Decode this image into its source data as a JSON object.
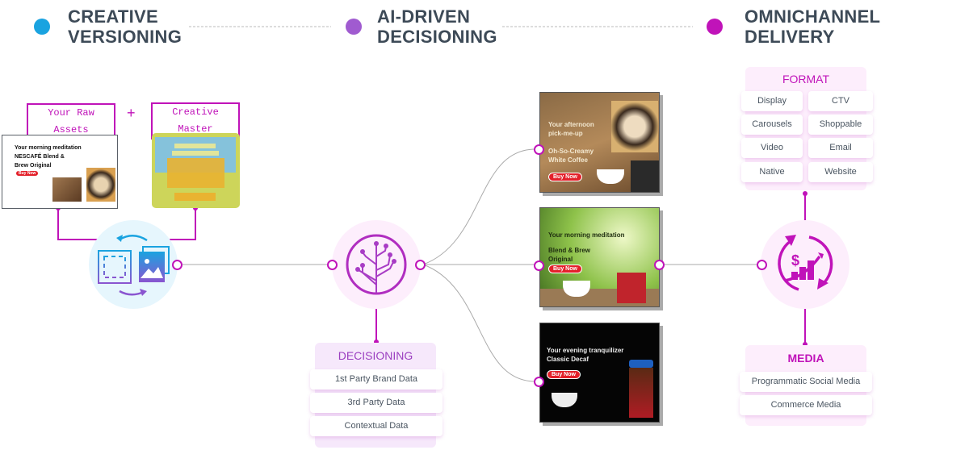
{
  "stages": [
    {
      "title_line1": "CREATIVE",
      "title_line2": "VERSIONING",
      "color": "#1aa3e0"
    },
    {
      "title_line1": "AI-DRIVEN",
      "title_line2": "DECISIONING",
      "color": "#a05bd0"
    },
    {
      "title_line1": "OMNICHANNEL",
      "title_line2": "DELIVERY",
      "color": "#c013b9"
    }
  ],
  "inputs": {
    "raw_assets": "Your Raw Assets",
    "plus": "+",
    "creative_master": "Creative Master"
  },
  "raw_ad": {
    "headline": "Your morning meditation",
    "product": "NESCAFÉ Blend & Brew Original",
    "cta": "Buy Now"
  },
  "ads": [
    {
      "headline": "Your afternoon pick-me-up",
      "product": "Oh-So-Creamy White Coffee",
      "cta": "Buy Now"
    },
    {
      "headline": "Your morning meditation",
      "product": "Blend & Brew Original",
      "cta": "Buy Now"
    },
    {
      "headline": "Your evening tranquilizer",
      "product": "Classic Decaf",
      "cta": "Buy Now"
    }
  ],
  "decisioning": {
    "title": "DECISIONING",
    "items": [
      "1st Party Brand Data",
      "3rd Party Data",
      "Contextual Data"
    ]
  },
  "format": {
    "title": "FORMAT",
    "items": [
      "Display",
      "CTV",
      "Carousels",
      "Shoppable",
      "Video",
      "Email",
      "Native",
      "Website"
    ]
  },
  "media": {
    "title": "MEDIA",
    "items": [
      "Programmatic Social Media",
      "Commerce Media"
    ]
  },
  "icons": [
    "image-versioning-icon",
    "decision-tree-icon",
    "revenue-growth-cycle-icon"
  ]
}
